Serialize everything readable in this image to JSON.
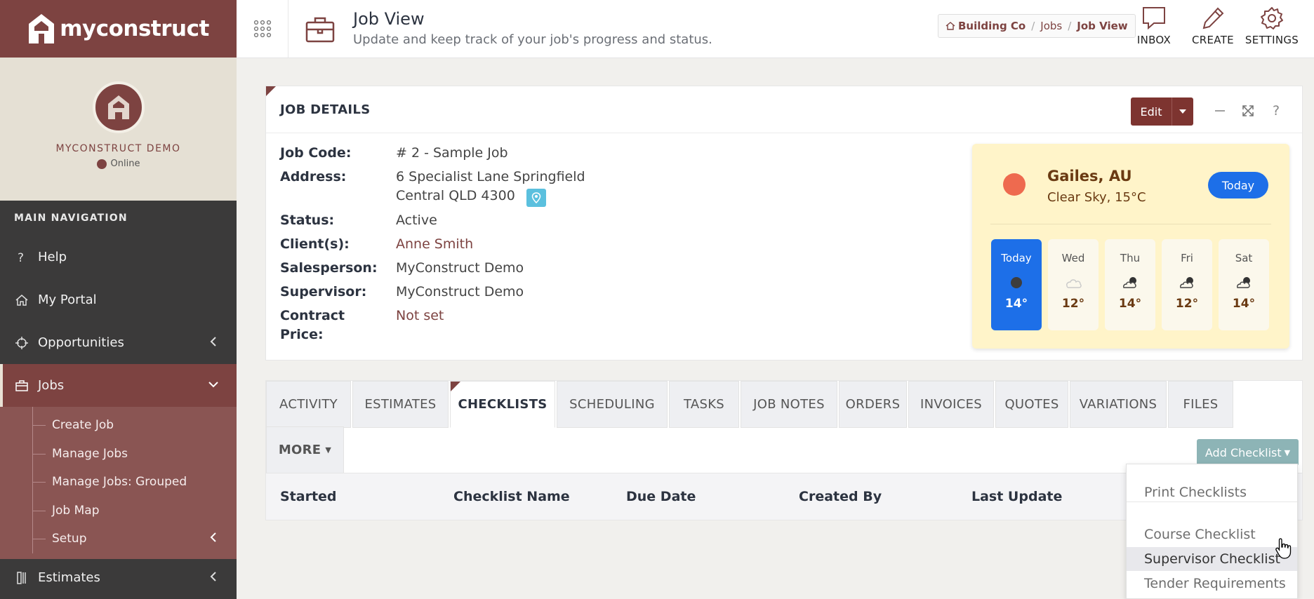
{
  "brand": {
    "name": "myconstruct"
  },
  "profile": {
    "name": "MYCONSTRUCT DEMO",
    "status": "Online"
  },
  "sidebar": {
    "header": "MAIN NAVIGATION",
    "items": [
      {
        "label": "Help",
        "icon": "question-icon"
      },
      {
        "label": "My Portal",
        "icon": "home-icon"
      },
      {
        "label": "Opportunities",
        "icon": "crosshair-icon"
      },
      {
        "label": "Jobs",
        "icon": "briefcase-icon",
        "active": true
      },
      {
        "label": "Estimates",
        "icon": "ruler-icon"
      }
    ],
    "jobs_submenu": [
      "Create Job",
      "Manage Jobs",
      "Manage Jobs: Grouped",
      "Job Map",
      "Setup"
    ]
  },
  "topbar": {
    "title": "Job View",
    "subtitle": "Update and keep track of your job's progress and status.",
    "breadcrumb": [
      "Building Co",
      "Jobs",
      "Job View"
    ],
    "actions": [
      "INBOX",
      "CREATE",
      "SETTINGS"
    ]
  },
  "job_details": {
    "title": "JOB DETAILS",
    "edit_label": "Edit",
    "fields": {
      "job_code_label": "Job Code:",
      "job_code": "# 2 - Sample Job",
      "address_label": "Address:",
      "address_line1": "6 Specialist Lane Springfield",
      "address_line2": "Central QLD 4300",
      "status_label": "Status:",
      "status": "Active",
      "clients_label": "Client(s):",
      "clients": "Anne Smith",
      "salesperson_label": "Salesperson:",
      "salesperson": "MyConstruct Demo",
      "supervisor_label": "Supervisor:",
      "supervisor": "MyConstruct Demo",
      "contract_label_1": "Contract",
      "contract_label_2": "Price:",
      "contract_price": "Not set"
    }
  },
  "weather": {
    "location": "Gailes, AU",
    "description": "Clear Sky, 15°C",
    "today_button": "Today",
    "days": [
      {
        "name": "Today",
        "temp": "14°",
        "icon": "clear-icon"
      },
      {
        "name": "Wed",
        "temp": "12°",
        "icon": "cloud-icon"
      },
      {
        "name": "Thu",
        "temp": "14°",
        "icon": "partly-cloudy-icon"
      },
      {
        "name": "Fri",
        "temp": "12°",
        "icon": "partly-cloudy-icon"
      },
      {
        "name": "Sat",
        "temp": "14°",
        "icon": "partly-cloudy-icon"
      }
    ]
  },
  "tabs": [
    "ACTIVITY",
    "ESTIMATES",
    "CHECKLISTS",
    "SCHEDULING",
    "TASKS",
    "JOB NOTES",
    "ORDERS",
    "INVOICES",
    "QUOTES",
    "VARIATIONS",
    "FILES"
  ],
  "more_tab": "MORE",
  "add_checklist": "Add Checklist",
  "table_columns": [
    "Started",
    "Checklist Name",
    "Due Date",
    "Created By",
    "Last Update"
  ],
  "dropdown": {
    "print": "Print Checklists",
    "items": [
      "Course Checklist",
      "Supervisor Checklist",
      "Tender Requirements"
    ]
  },
  "colors": {
    "brand": "#7d4341",
    "accent_blue": "#1d6fe8",
    "weather_bg": "#fff4c9"
  }
}
